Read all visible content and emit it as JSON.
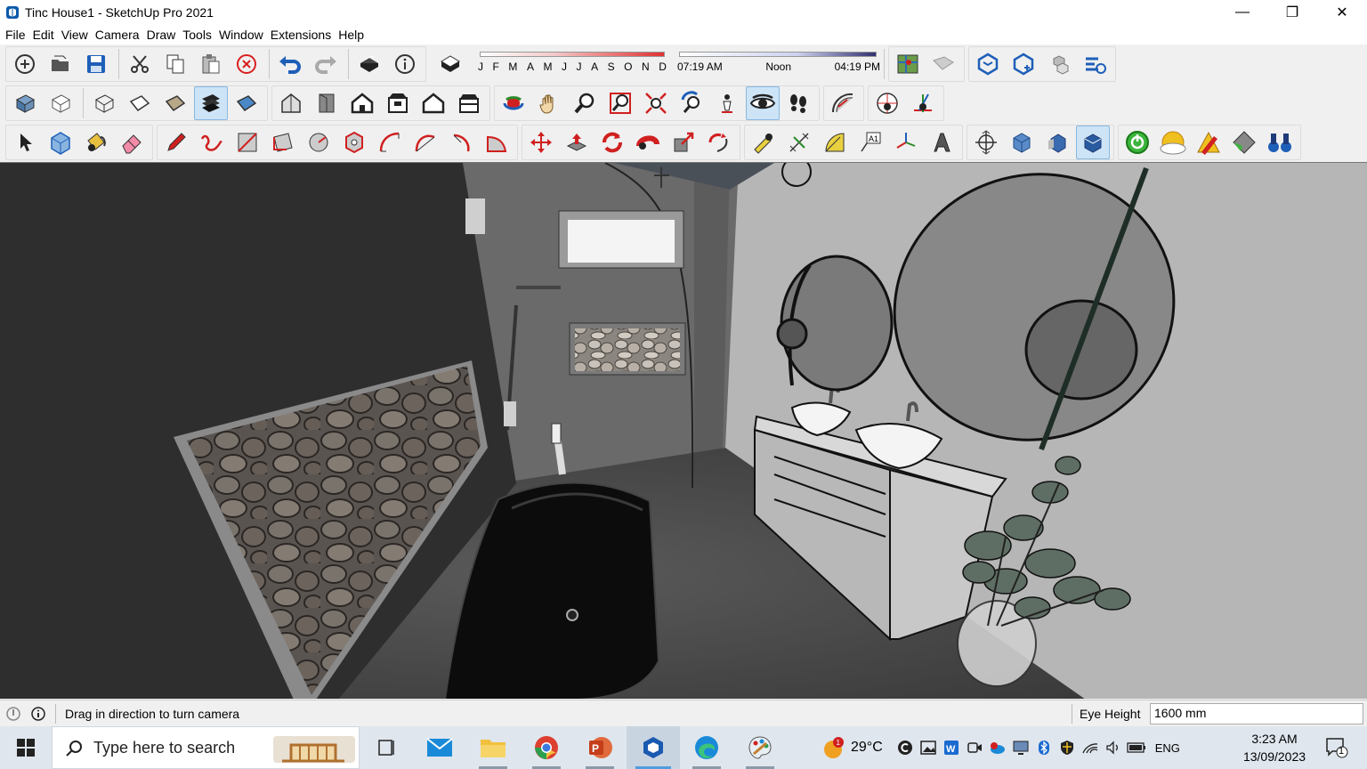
{
  "window": {
    "title": "Tinc House1 - SketchUp Pro 2021",
    "minimize": "—",
    "restore": "❐",
    "close": "✕"
  },
  "menu": [
    "File",
    "Edit",
    "View",
    "Camera",
    "Draw",
    "Tools",
    "Window",
    "Extensions",
    "Help"
  ],
  "shadows": {
    "months": [
      "J",
      "F",
      "M",
      "A",
      "M",
      "J",
      "J",
      "A",
      "S",
      "O",
      "N",
      "D"
    ],
    "time_start": "07:19 AM",
    "time_mid": "Noon",
    "time_end": "04:19 PM"
  },
  "status": {
    "message": "Drag in direction to turn camera",
    "eye_height_label": "Eye Height",
    "eye_height_value": "1600 mm"
  },
  "taskbar": {
    "search_placeholder": "Type here to search",
    "weather": "29°C",
    "language": "ENG",
    "time": "3:23 AM",
    "date": "13/09/2023",
    "notifications": "1"
  },
  "colors": {
    "accent": "#0063b1",
    "active_tool": "#cde4f7"
  }
}
